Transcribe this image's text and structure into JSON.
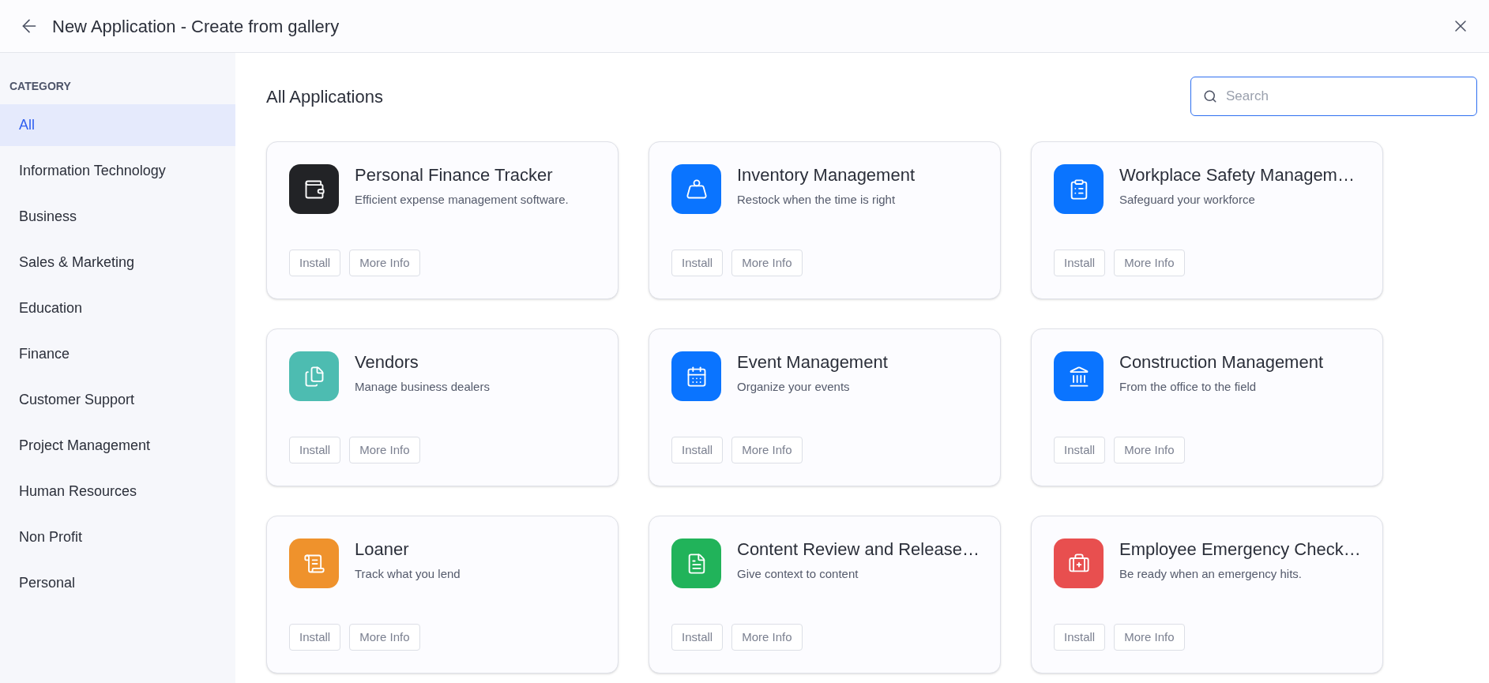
{
  "header": {
    "title": "New Application - Create from gallery"
  },
  "sidebar": {
    "heading": "CATEGORY",
    "items": [
      {
        "label": "All",
        "selected": true
      },
      {
        "label": "Information Technology",
        "selected": false
      },
      {
        "label": "Business",
        "selected": false
      },
      {
        "label": "Sales & Marketing",
        "selected": false
      },
      {
        "label": "Education",
        "selected": false
      },
      {
        "label": "Finance",
        "selected": false
      },
      {
        "label": "Customer Support",
        "selected": false
      },
      {
        "label": "Project Management",
        "selected": false
      },
      {
        "label": "Human Resources",
        "selected": false
      },
      {
        "label": "Non Profit",
        "selected": false
      },
      {
        "label": "Personal",
        "selected": false
      }
    ]
  },
  "main": {
    "title": "All Applications",
    "search": {
      "placeholder": "Search"
    },
    "apps": [
      {
        "title": "Personal Finance Tracker",
        "description": "Efficient expense management software.",
        "color": "#222326",
        "buttons": [
          "Install",
          "More Info"
        ]
      },
      {
        "title": "Inventory Management",
        "description": "Restock when the time is right",
        "color": "#0a74ff",
        "buttons": [
          "Install",
          "More Info"
        ]
      },
      {
        "title": "Workplace Safety Managem…",
        "description": "Safeguard your workforce",
        "color": "#0a74ff",
        "buttons": [
          "Install",
          "More Info"
        ]
      },
      {
        "title": "Vendors",
        "description": "Manage business dealers",
        "color": "#4dbcb1",
        "buttons": [
          "Install",
          "More Info"
        ]
      },
      {
        "title": "Event Management",
        "description": "Organize your events",
        "color": "#0a74ff",
        "buttons": [
          "Install",
          "More Info"
        ]
      },
      {
        "title": "Construction Management",
        "description": "From the office to the field",
        "color": "#0a74ff",
        "buttons": [
          "Install",
          "More Info"
        ]
      },
      {
        "title": "Loaner",
        "description": "Track what you lend",
        "color": "#ef922c",
        "buttons": [
          "Install",
          "More Info"
        ]
      },
      {
        "title": "Content Review and Release…",
        "description": "Give context to content",
        "color": "#21b35a",
        "buttons": [
          "Install",
          "More Info"
        ]
      },
      {
        "title": "Employee Emergency Check…",
        "description": "Be ready when an emergency hits.",
        "color": "#e84f4f",
        "buttons": [
          "Install",
          "More Info"
        ]
      }
    ]
  }
}
